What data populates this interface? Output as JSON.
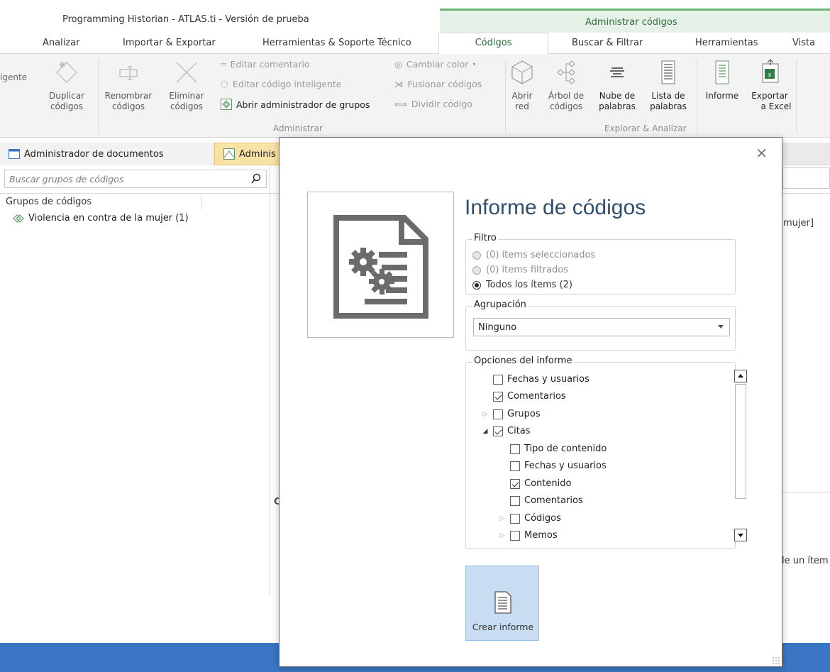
{
  "window": {
    "title": "Programming Historian - ATLAS.ti - Versión de prueba",
    "context_title": "Administrar códigos"
  },
  "tabs": [
    "Analizar",
    "Importar & Exportar",
    "Herramientas & Soporte Técnico",
    "Códigos",
    "Buscar & Filtrar",
    "Herramientas",
    "Vista"
  ],
  "ribbon": {
    "partial_cut_1": "igente",
    "duplicate": {
      "l1": "Duplicar",
      "l2": "códigos"
    },
    "rename": {
      "l1": "Renombrar",
      "l2": "códigos"
    },
    "delete": {
      "l1": "Eliminar",
      "l2": "códigos"
    },
    "edit_comment": "Editar comentario",
    "edit_smart_code": "Editar código inteligente",
    "open_group_manager": "Abrir administrador de grupos",
    "change_color": "Cambiar color",
    "merge_codes": "Fusionar códigos",
    "split_code": "Dividir código",
    "group_manage": "Administrar",
    "open_network": {
      "l1": "Abrir",
      "l2": "red"
    },
    "code_tree": {
      "l1": "Árbol de",
      "l2": "códigos"
    },
    "word_cloud": {
      "l1": "Nube de",
      "l2": "palabras"
    },
    "word_list": {
      "l1": "Lista de",
      "l2": "palabras"
    },
    "report": "Informe",
    "export_excel": {
      "l1": "Exportar",
      "l2": "a Excel"
    },
    "group_explore": "Explorar & Analizar"
  },
  "doc_tabs": {
    "documents_manager": "Administrador de documentos",
    "codes_manager_partial": "Adminis"
  },
  "left_panel": {
    "search_placeholder": "Buscar grupos de códigos",
    "column_header": "Grupos de códigos",
    "items": [
      {
        "label": "Violencia en contra de la mujer (1)"
      }
    ]
  },
  "background_fragments": {
    "right_text_1": "mujer]",
    "right_text_2": "le un ítem",
    "letter": "C"
  },
  "dialog": {
    "title": "Informe de códigos",
    "close_glyph": "✕",
    "filter": {
      "legend": "Filtro",
      "options": [
        {
          "label": "(0) ítems seleccionados",
          "selected": false,
          "enabled": false
        },
        {
          "label": "(0) ítems filtrados",
          "selected": false,
          "enabled": false
        },
        {
          "label": "Todos los ítems (2)",
          "selected": true,
          "enabled": true
        }
      ]
    },
    "grouping": {
      "legend": "Agrupación",
      "selected": "Ninguno"
    },
    "report_options": {
      "legend": "Opciones del informe",
      "items": [
        {
          "label": "Fechas y usuarios",
          "checked": false,
          "level": 0,
          "expander": "none"
        },
        {
          "label": "Comentarios",
          "checked": true,
          "level": 0,
          "expander": "none"
        },
        {
          "label": "Grupos",
          "checked": false,
          "level": 0,
          "expander": "collapsed"
        },
        {
          "label": "Citas",
          "checked": true,
          "level": 0,
          "expander": "expanded"
        },
        {
          "label": "Tipo de contenido",
          "checked": false,
          "level": 1,
          "expander": "none"
        },
        {
          "label": "Fechas y usuarios",
          "checked": false,
          "level": 1,
          "expander": "none"
        },
        {
          "label": "Contenido",
          "checked": true,
          "level": 1,
          "expander": "none"
        },
        {
          "label": "Comentarios",
          "checked": false,
          "level": 1,
          "expander": "none"
        },
        {
          "label": "Códigos",
          "checked": false,
          "level": 1,
          "expander": "collapsed"
        },
        {
          "label": "Memos",
          "checked": false,
          "level": 1,
          "expander": "collapsed"
        }
      ]
    },
    "create_button": "Crear informe"
  },
  "colors": {
    "accent_green": "#6bb37a",
    "status_blue": "#3a76c4",
    "dialog_title": "#2f4e6f",
    "create_button_bg": "#c9ddf2"
  }
}
